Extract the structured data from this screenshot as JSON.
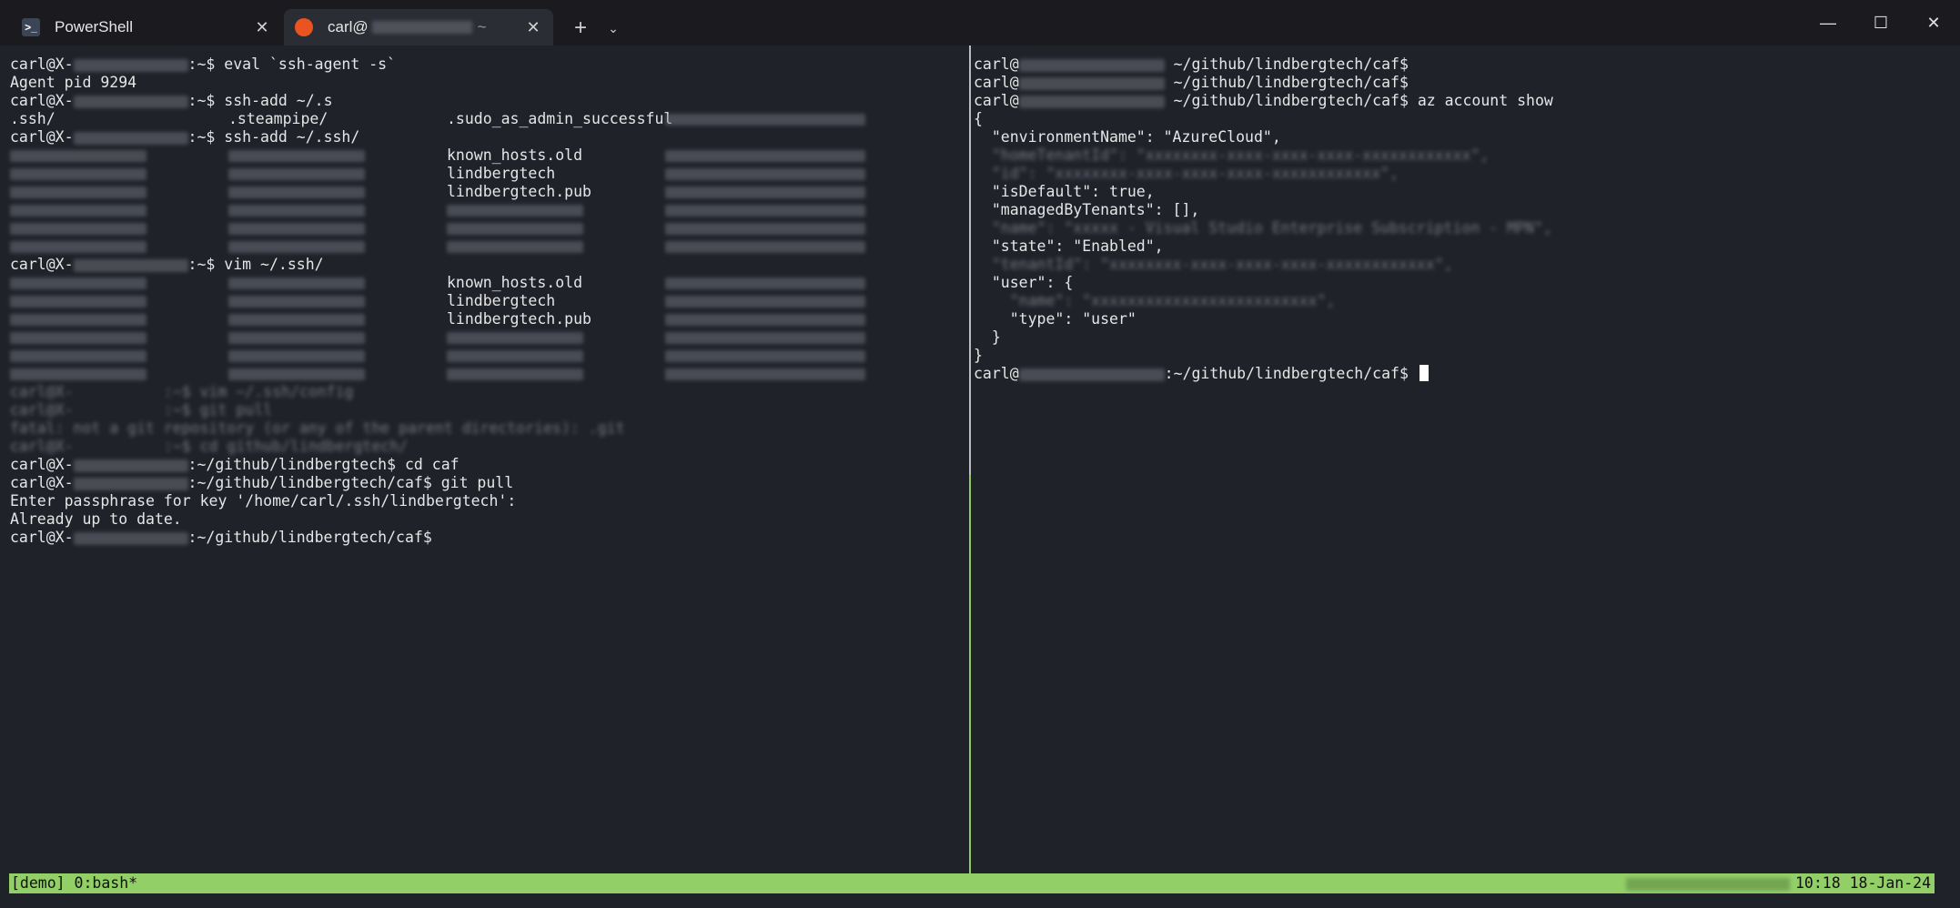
{
  "window": {
    "tabs": [
      {
        "label": "PowerShell",
        "icon": "powershell-icon"
      },
      {
        "label": "carl@",
        "icon": "ubuntu-icon"
      }
    ],
    "controls": {
      "minimize": "—",
      "maximize": "☐",
      "close": "✕"
    }
  },
  "left_pane": {
    "lines": [
      {
        "type": "cmd",
        "user": "carl@X-",
        "path": ":~$",
        "cmd": " eval `ssh-agent -s`"
      },
      {
        "type": "text",
        "text": "Agent pid 9294"
      },
      {
        "type": "cmd",
        "user": "carl@X-",
        "path": ":~$",
        "cmd": " ssh-add ~/.s"
      },
      {
        "type": "cols",
        "cols": [
          ".ssh/",
          ".steampipe/",
          ".sudo_as_admin_successful",
          ""
        ]
      },
      {
        "type": "cmd",
        "user": "carl@X-",
        "path": ":~$",
        "cmd": " ssh-add ~/.ssh/"
      },
      {
        "type": "cols",
        "cols": [
          "",
          "",
          "known_hosts.old",
          ""
        ]
      },
      {
        "type": "cols",
        "cols": [
          "",
          "",
          "lindbergtech",
          ""
        ]
      },
      {
        "type": "cols",
        "cols": [
          "",
          "",
          "lindbergtech.pub",
          ""
        ]
      },
      {
        "type": "cols",
        "cols": [
          "",
          "",
          "",
          ""
        ]
      },
      {
        "type": "cols",
        "cols": [
          "",
          "",
          "",
          ""
        ]
      },
      {
        "type": "cols",
        "cols": [
          "",
          "",
          "",
          ""
        ]
      },
      {
        "type": "cmd",
        "user": "carl@X-",
        "path": ":~$",
        "cmd": " vim ~/.ssh/"
      },
      {
        "type": "cols",
        "cols": [
          "",
          "",
          "known_hosts.old",
          ""
        ]
      },
      {
        "type": "cols",
        "cols": [
          "",
          "",
          "lindbergtech",
          ""
        ]
      },
      {
        "type": "cols",
        "cols": [
          "",
          "",
          "lindbergtech.pub",
          ""
        ]
      },
      {
        "type": "cols",
        "cols": [
          "",
          "",
          "",
          ""
        ]
      },
      {
        "type": "cols",
        "cols": [
          "",
          "",
          "",
          ""
        ]
      },
      {
        "type": "cols",
        "cols": [
          "",
          "",
          "",
          ""
        ]
      },
      {
        "type": "blur",
        "text": "carl@X-          :~$ vim ~/.ssh/config"
      },
      {
        "type": "blur",
        "text": "carl@X-          :~$ git pull"
      },
      {
        "type": "blur",
        "text": "fatal: not a git repository (or any of the parent directories): .git"
      },
      {
        "type": "blur",
        "text": "carl@X-          :~$ cd github/lindbergtech/"
      },
      {
        "type": "cmd",
        "user": "carl@X-",
        "path": ":~/github/lindbergtech$",
        "cmd": " cd caf"
      },
      {
        "type": "cmd",
        "user": "carl@X-",
        "path": ":~/github/lindbergtech/caf$",
        "cmd": " git pull"
      },
      {
        "type": "text",
        "text": "Enter passphrase for key '/home/carl/.ssh/lindbergtech':"
      },
      {
        "type": "text",
        "text": "Already up to date."
      },
      {
        "type": "cmd",
        "user": "carl@X-",
        "path": ":~/github/lindbergtech/caf$",
        "cmd": ""
      }
    ]
  },
  "right_pane": {
    "lines": [
      {
        "type": "cmd",
        "user": "carl@",
        "path": " ~/github/lindbergtech/caf$",
        "cmd": ""
      },
      {
        "type": "cmd",
        "user": "carl@",
        "path": " ~/github/lindbergtech/caf$",
        "cmd": ""
      },
      {
        "type": "cmd",
        "user": "carl@",
        "path": " ~/github/lindbergtech/caf$",
        "cmd": " az account show"
      },
      {
        "type": "text",
        "text": "{"
      },
      {
        "type": "text",
        "text": "  \"environmentName\": \"AzureCloud\","
      },
      {
        "type": "blur",
        "text": "  \"homeTenantId\": \"xxxxxxxx-xxxx-xxxx-xxxx-xxxxxxxxxxxx\","
      },
      {
        "type": "blur",
        "text": "  \"id\": \"xxxxxxxx-xxxx-xxxx-xxxx-xxxxxxxxxxxx\","
      },
      {
        "type": "text",
        "text": "  \"isDefault\": true,"
      },
      {
        "type": "text",
        "text": "  \"managedByTenants\": [],"
      },
      {
        "type": "blur",
        "text": "  \"name\": \"xxxxx - Visual Studio Enterprise Subscription - MPN\","
      },
      {
        "type": "text",
        "text": "  \"state\": \"Enabled\","
      },
      {
        "type": "blur",
        "text": "  \"tenantId\": \"xxxxxxxx-xxxx-xxxx-xxxx-xxxxxxxxxxxx\","
      },
      {
        "type": "text",
        "text": "  \"user\": {"
      },
      {
        "type": "blur",
        "text": "    \"name\": \"xxxxxxxxxxxxxxxxxxxxxxxxx\","
      },
      {
        "type": "text",
        "text": "    \"type\": \"user\""
      },
      {
        "type": "text",
        "text": "  }"
      },
      {
        "type": "text",
        "text": "}"
      },
      {
        "type": "cmd",
        "user": "carl@",
        "path": ":~/github/lindbergtech/caf$",
        "cmd": " ",
        "cursor": true
      }
    ]
  },
  "status_bar": {
    "left": "[demo] 0:bash*",
    "time": "10:18",
    "date": "18-Jan-24"
  },
  "colors": {
    "background": "#20222a",
    "text": "#e6e6e6",
    "status_bar": "#93cf67",
    "pane_border_active": "#91c95f"
  }
}
